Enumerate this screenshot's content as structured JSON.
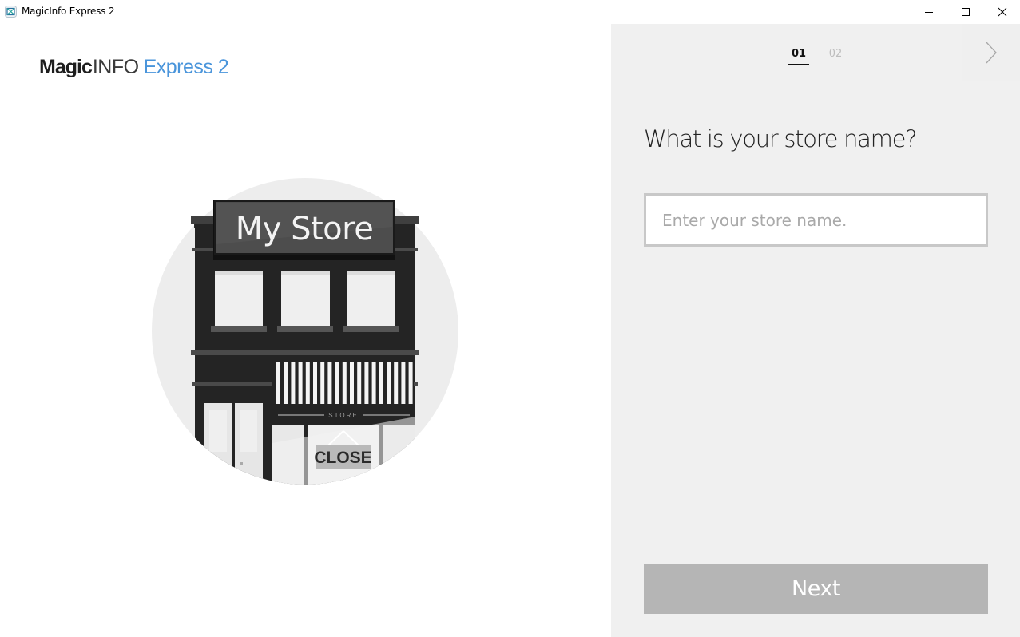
{
  "window": {
    "title": "MagicInfo Express 2",
    "icon": "magicinfo-app-icon",
    "controls": {
      "minimize": "minimize-icon",
      "maximize": "maximize-icon",
      "close": "close-icon"
    }
  },
  "logo": {
    "part1": "Magic",
    "part2": "INFO",
    "part3": "Express 2",
    "accent_color": "#4a95db"
  },
  "illustration": {
    "sign_text": "My Store",
    "awning_text": "STORE",
    "door_sign_text": "CLOSE"
  },
  "wizard": {
    "steps": [
      {
        "label": "01",
        "active": true
      },
      {
        "label": "02",
        "active": false
      }
    ],
    "next_arrow_icon": "chevron-right-icon",
    "question": "What is your store name?",
    "input": {
      "value": "",
      "placeholder": "Enter your store name."
    },
    "next_button_label": "Next",
    "next_button_color": "#b5b5b5"
  }
}
